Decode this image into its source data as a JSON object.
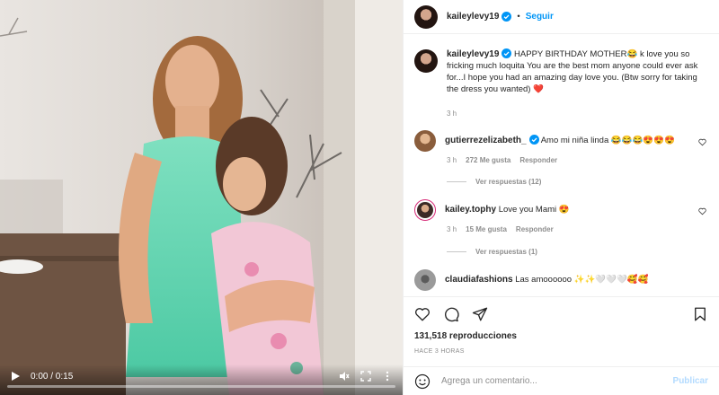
{
  "media": {
    "time": "0:00 / 0:15",
    "progress": 0.0,
    "icons": [
      "play-icon",
      "mute-icon",
      "fullscreen-icon",
      "more-icon"
    ]
  },
  "header": {
    "username": "kaileylevy19",
    "separator": "•",
    "follow_label": "Seguir"
  },
  "caption": {
    "username": "kaileylevy19",
    "text": "HAPPY BIRTHDAY MOTHER😂 k love you so fricking much loquita You are the best mom anyone could ever ask for...I hope you had an amazing day love you. (Btw sorry for taking the dress you wanted) ❤️",
    "time": "3 h"
  },
  "comments": [
    {
      "username": "gutierrezelizabeth_",
      "verified": true,
      "text": "Amo mi niña linda 😂😂😂😍😍😍",
      "time": "3 h",
      "likes": "272 Me gusta",
      "reply_label": "Responder",
      "view_replies": "Ver respuestas (12)"
    },
    {
      "username": "kailey.tophy",
      "verified": false,
      "text": "Love you Mami 😍",
      "time": "3 h",
      "likes": "15 Me gusta",
      "reply_label": "Responder",
      "view_replies": "Ver respuestas (1)"
    },
    {
      "username": "claudiafashions",
      "verified": false,
      "text": "Las amoooooo ✨✨🤍🤍🤍🥰🥰"
    }
  ],
  "actions": {
    "icons": [
      "heart-icon",
      "comment-icon",
      "share-icon",
      "bookmark-icon"
    ]
  },
  "stats": {
    "views": "131,518 reproducciones",
    "posted": "HACE 3 HORAS"
  },
  "composer": {
    "placeholder": "Agrega un comentario...",
    "publish_label": "Publicar"
  },
  "colors": {
    "accent": "#0095f6",
    "publish_disabled": "#b3dbff",
    "heart_red": "#ed4956",
    "muted": "#8e8e8e"
  }
}
